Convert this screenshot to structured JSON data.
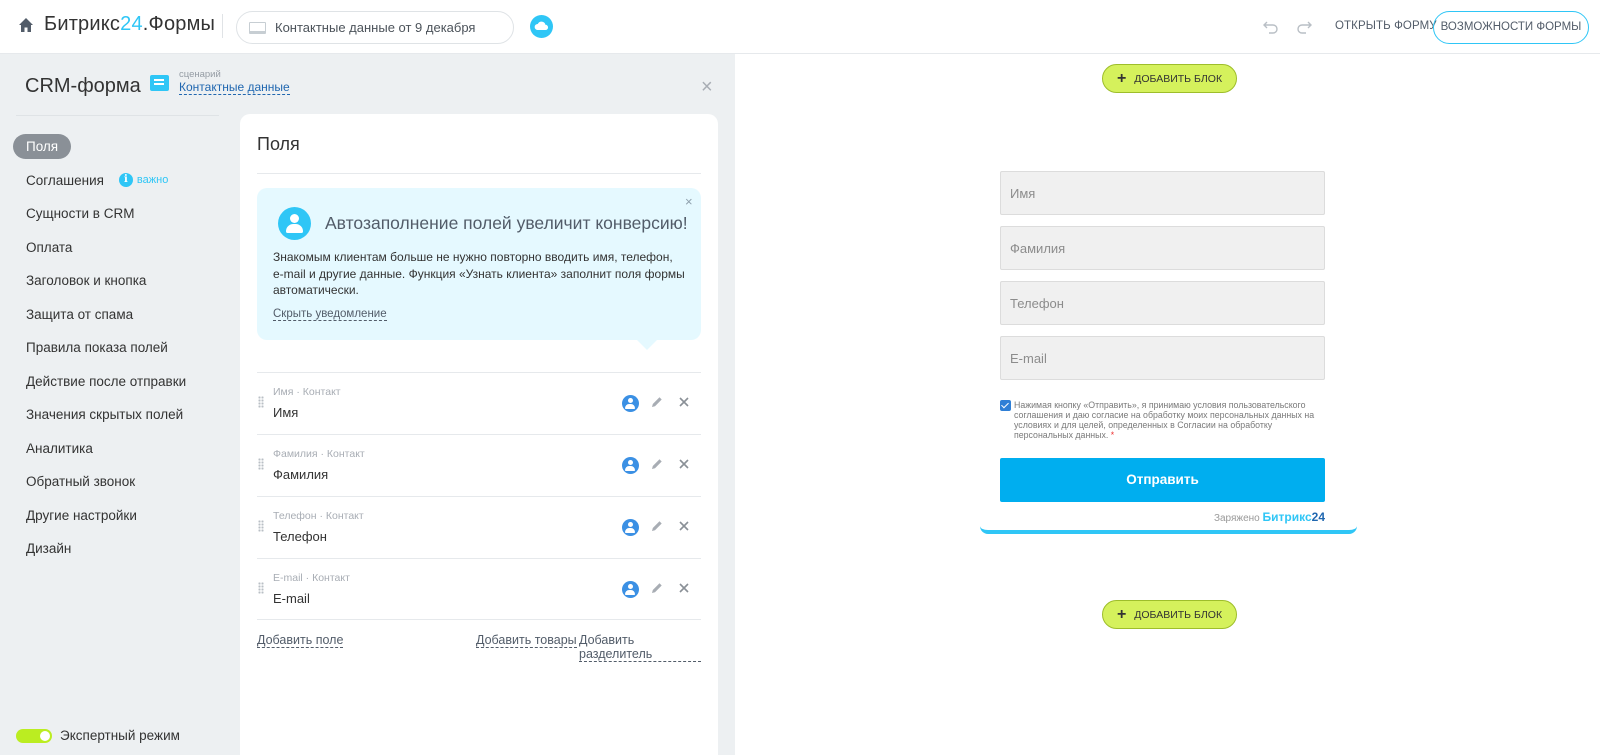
{
  "topbar": {
    "brand_main": "Битрикс",
    "brand_num": "24",
    "brand_suffix": ".Формы",
    "form_name": "Контактные данные от 9 декабря",
    "open_form": "ОТКРЫТЬ ФОРМУ",
    "features": "ВОЗМОЖНОСТИ ФОРМЫ"
  },
  "sidebar": {
    "title": "CRM-форма",
    "scenario_caption": "сценарий",
    "scenario_link": "Контактные данные",
    "important_label": "важно",
    "items": [
      {
        "label": "Поля"
      },
      {
        "label": "Соглашения"
      },
      {
        "label": "Сущности в CRM"
      },
      {
        "label": "Оплата"
      },
      {
        "label": "Заголовок и кнопка"
      },
      {
        "label": "Защита от спама"
      },
      {
        "label": "Правила показа полей"
      },
      {
        "label": "Действие после отправки"
      },
      {
        "label": "Значения скрытых полей"
      },
      {
        "label": "Аналитика"
      },
      {
        "label": "Обратный звонок"
      },
      {
        "label": "Другие настройки"
      },
      {
        "label": "Дизайн"
      }
    ],
    "expert_mode": "Экспертный режим"
  },
  "panel": {
    "title": "Поля",
    "notice": {
      "title": "Автозаполнение полей увеличит конверсию!",
      "text": "Знакомым клиентам больше не нужно повторно вводить имя, телефон, e-mail и другие данные. Функция «Узнать клиента» заполнит поля формы автоматически.",
      "hide": "Скрыть уведомление"
    },
    "fields": [
      {
        "meta": "Имя · Контакт",
        "name": "Имя"
      },
      {
        "meta": "Фамилия · Контакт",
        "name": "Фамилия"
      },
      {
        "meta": "Телефон · Контакт",
        "name": "Телефон"
      },
      {
        "meta": "E-mail · Контакт",
        "name": "E-mail"
      }
    ],
    "add_field": "Добавить поле",
    "add_products": "Добавить товары",
    "add_separator": "Добавить разделитель"
  },
  "preview": {
    "add_block": "ДОБАВИТЬ БЛОК",
    "inputs": [
      "Имя",
      "Фамилия",
      "Телефон",
      "E-mail"
    ],
    "agreement": "Нажимая кнопку «Отправить», я принимаю условия пользовательского соглашения и даю согласие на обработку моих персональных данных на условиях и для целей, определенных в Согласии на обработку персональных данных.",
    "agreement_required": "*",
    "submit": "Отправить",
    "charged_by": "Заряжено",
    "charged_brand": "Битрикс",
    "charged_num": "24"
  },
  "colors": {
    "accent": "#2fc6f6",
    "submit": "#00aeef",
    "add_block": "#d5f15c",
    "toggle_on": "#bbed21"
  }
}
